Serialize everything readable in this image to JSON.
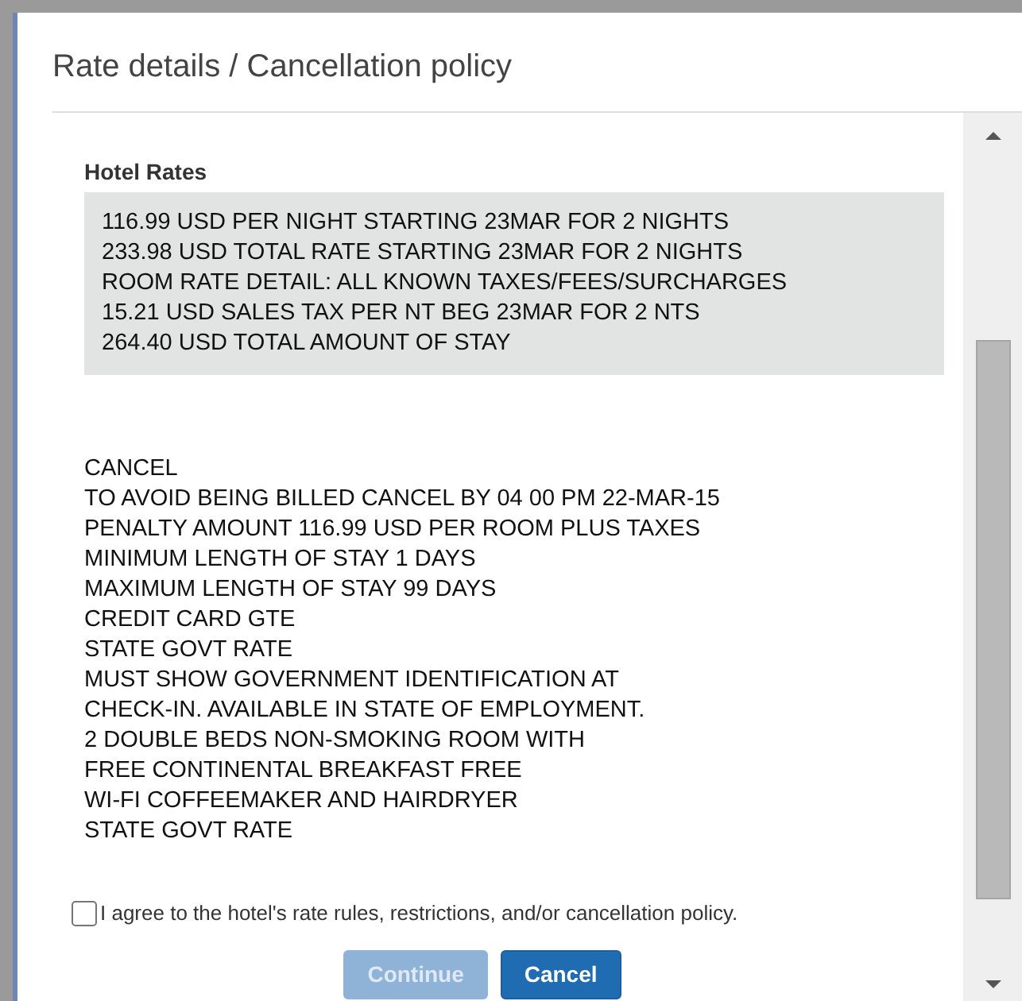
{
  "dialog": {
    "title": "Rate details / Cancellation policy"
  },
  "hotel_rates": {
    "heading": "Hotel Rates",
    "lines": [
      "116.99 USD PER NIGHT STARTING 23MAR FOR 2 NIGHTS",
      "233.98 USD TOTAL RATE STARTING 23MAR FOR 2 NIGHTS",
      "ROOM RATE DETAIL: ALL KNOWN TAXES/FEES/SURCHARGES",
      "15.21 USD SALES TAX PER NT BEG 23MAR FOR 2 NTS",
      "264.40 USD TOTAL AMOUNT OF STAY"
    ]
  },
  "policy_lines": [
    "CANCEL",
    "TO AVOID BEING BILLED CANCEL BY 04 00 PM 22-MAR-15",
    "PENALTY AMOUNT 116.99 USD PER ROOM PLUS TAXES",
    "MINIMUM LENGTH OF STAY 1 DAYS",
    "MAXIMUM LENGTH OF STAY 99 DAYS",
    "CREDIT CARD GTE",
    "STATE GOVT RATE",
    "MUST SHOW GOVERNMENT IDENTIFICATION AT",
    "CHECK-IN. AVAILABLE IN STATE OF EMPLOYMENT.",
    "2 DOUBLE BEDS NON-SMOKING ROOM WITH",
    "FREE CONTINENTAL BREAKFAST FREE",
    "WI-FI COFFEEMAKER AND HAIRDRYER",
    "STATE GOVT RATE"
  ],
  "agreement": {
    "label": "I agree to the hotel's rate rules, restrictions, and/or cancellation policy.",
    "checked": false
  },
  "buttons": [
    {
      "label": "Continue",
      "disabled": true
    },
    {
      "label": "Cancel",
      "disabled": false
    }
  ]
}
